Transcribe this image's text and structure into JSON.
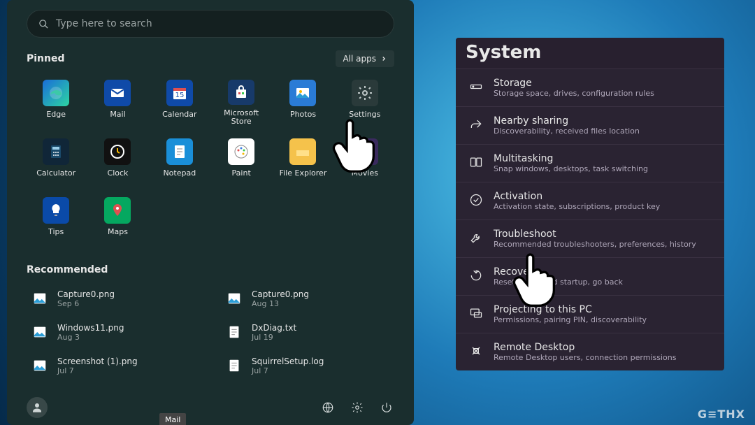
{
  "start": {
    "search_placeholder": "Type here to search",
    "pinned_title": "Pinned",
    "all_apps_label": "All apps",
    "recommended_title": "Recommended",
    "tooltip_mail": "Mail",
    "pinned": [
      {
        "label": "Edge",
        "icon": "edge"
      },
      {
        "label": "Mail",
        "icon": "mail"
      },
      {
        "label": "Calendar",
        "icon": "calendar"
      },
      {
        "label": "Microsoft Store",
        "icon": "store"
      },
      {
        "label": "Photos",
        "icon": "photos"
      },
      {
        "label": "Settings",
        "icon": "settings"
      },
      {
        "label": "Calculator",
        "icon": "calculator"
      },
      {
        "label": "Clock",
        "icon": "clock"
      },
      {
        "label": "Notepad",
        "icon": "notepad"
      },
      {
        "label": "Paint",
        "icon": "paint"
      },
      {
        "label": "File Explorer",
        "icon": "fileexplorer"
      },
      {
        "label": "Movies",
        "icon": "movies"
      },
      {
        "label": "Tips",
        "icon": "tips"
      },
      {
        "label": "Maps",
        "icon": "maps"
      }
    ],
    "recommended": [
      {
        "name": "Capture0.png",
        "date": "Sep 6",
        "type": "image"
      },
      {
        "name": "Capture0.png",
        "date": "Aug 13",
        "type": "image"
      },
      {
        "name": "Windows11.png",
        "date": "Aug 3",
        "type": "image"
      },
      {
        "name": "DxDiag.txt",
        "date": "Jul 19",
        "type": "text"
      },
      {
        "name": "Screenshot (1).png",
        "date": "Jul 7",
        "type": "image"
      },
      {
        "name": "SquirrelSetup.log",
        "date": "Jul 7",
        "type": "text"
      }
    ]
  },
  "system": {
    "title": "System",
    "items": [
      {
        "title": "Storage",
        "desc": "Storage space, drives, configuration rules",
        "icon": "storage"
      },
      {
        "title": "Nearby sharing",
        "desc": "Discoverability, received files location",
        "icon": "share"
      },
      {
        "title": "Multitasking",
        "desc": "Snap windows, desktops, task switching",
        "icon": "multitask"
      },
      {
        "title": "Activation",
        "desc": "Activation state, subscriptions, product key",
        "icon": "check"
      },
      {
        "title": "Troubleshoot",
        "desc": "Recommended troubleshooters, preferences, history",
        "icon": "wrench"
      },
      {
        "title": "Recovery",
        "desc": "Reset, advanced startup, go back",
        "icon": "recovery"
      },
      {
        "title": "Projecting to this PC",
        "desc": "Permissions, pairing PIN, discoverability",
        "icon": "project"
      },
      {
        "title": "Remote Desktop",
        "desc": "Remote Desktop users, connection permissions",
        "icon": "remote"
      }
    ]
  },
  "watermark": "G≡THX"
}
